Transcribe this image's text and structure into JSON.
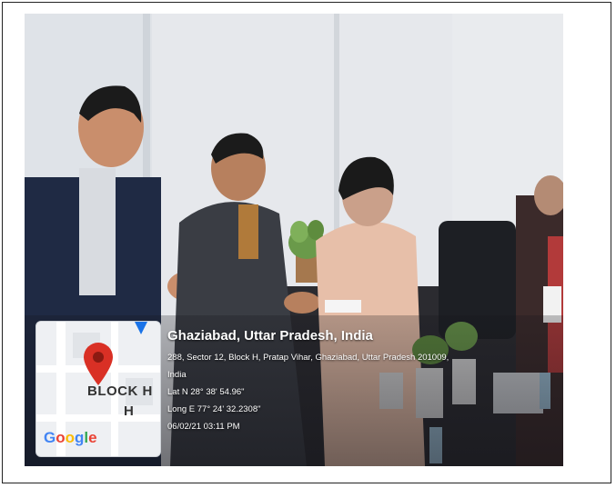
{
  "location": {
    "title": "Ghaziabad, Uttar Pradesh, India",
    "address_line1": "288, Sector 12, Block H, Pratap Vihar, Ghaziabad, Uttar Pradesh 201009,",
    "address_line2": "India",
    "lat": "Lat N 28° 38' 54.96\"",
    "long": "Long E 77° 24' 32.2308\"",
    "datetime": "06/02/21 03:11 PM"
  },
  "map": {
    "label_line1": "BLOCK H",
    "label_line2": "H",
    "brand": "Google",
    "pin_color": "#d93025"
  }
}
